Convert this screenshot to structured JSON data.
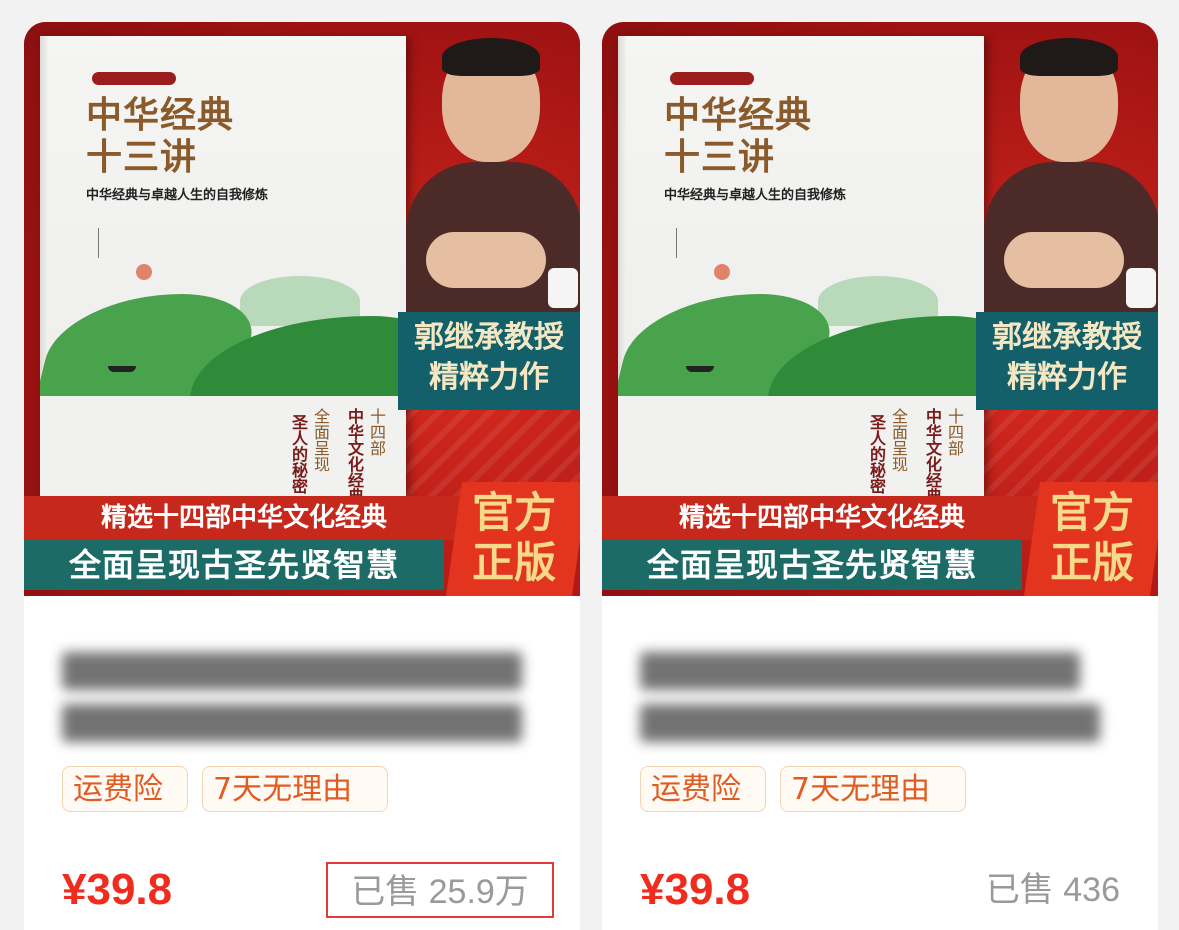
{
  "products": [
    {
      "cover": {
        "book_title_line1": "中华经典",
        "book_title_line2": "十三讲",
        "book_subtitle": "中华经典与卓越人生的自我修炼",
        "vertical_text_1": "全面呈现",
        "vertical_text_2": "圣人的秘密",
        "vertical_text_3": "十四部",
        "vertical_text_4": "中华文化经典",
        "author_banner_line1": "郭继承教授",
        "author_banner_line2": "精粹力作",
        "banner_line1": "精选十四部中华文化经典",
        "banner_line2": "全面呈现古圣先贤智慧",
        "official_line1": "官方",
        "official_line2": "正版"
      },
      "tags": [
        "运费险",
        "7天无理由"
      ],
      "price": "¥39.8",
      "sold": "已售 25.9万",
      "highlight": true
    },
    {
      "cover": {
        "book_title_line1": "中华经典",
        "book_title_line2": "十三讲",
        "book_subtitle": "中华经典与卓越人生的自我修炼",
        "vertical_text_1": "全面呈现",
        "vertical_text_2": "圣人的秘密",
        "vertical_text_3": "十四部",
        "vertical_text_4": "中华文化经典",
        "author_banner_line1": "郭继承教授",
        "author_banner_line2": "精粹力作",
        "banner_line1": "精选十四部中华文化经典",
        "banner_line2": "全面呈现古圣先贤智慧",
        "official_line1": "官方",
        "official_line2": "正版"
      },
      "tags": [
        "运费险",
        "7天无理由"
      ],
      "price": "¥39.8",
      "sold": "已售 436",
      "highlight": false
    }
  ],
  "colors": {
    "price": "#f02c1f",
    "tag_text": "#e05c22",
    "highlight_border": "#e53935",
    "cover_red": "#b51a1a",
    "cover_teal": "#1d6b66"
  }
}
